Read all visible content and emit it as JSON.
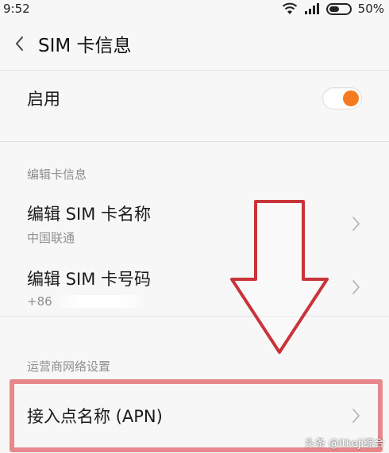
{
  "status_bar": {
    "time": "9:52",
    "battery": "50%",
    "battery_level": 0.5
  },
  "header": {
    "title": "SIM 卡信息"
  },
  "enable": {
    "label": "启用",
    "toggle_on": true
  },
  "section_card": {
    "title": "编辑卡信息"
  },
  "edit_name": {
    "label": "编辑 SIM 卡名称",
    "sub": "中国联通"
  },
  "edit_number": {
    "label": "编辑 SIM 卡号码",
    "sub": "+86"
  },
  "section_carrier": {
    "title": "运营商网络设置"
  },
  "apn": {
    "label": "接入点名称 (APN)"
  },
  "watermark": "头条 @itkeji综合",
  "colors": {
    "accent": "#f57a1f",
    "highlight": "#e8888c",
    "arrow": "#c8343a",
    "secondary_text": "#8f8f8f"
  },
  "icons": {
    "back": "chevron-left-icon",
    "row_arrow": "chevron-right-icon",
    "wifi": "wifi-icon",
    "signal": "signal-icon",
    "battery": "battery-icon"
  }
}
